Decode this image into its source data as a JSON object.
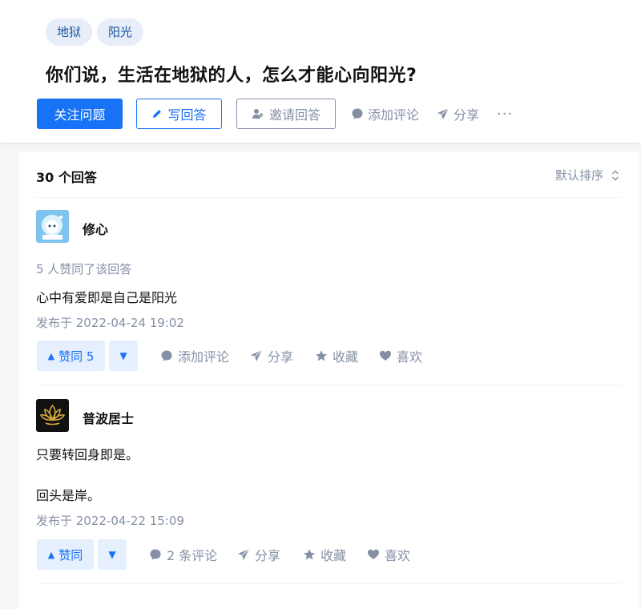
{
  "question": {
    "tags": [
      "地狱",
      "阳光"
    ],
    "title": "你们说，生活在地狱的人，怎么才能心向阳光?",
    "follow_label": "关注问题",
    "write_label": "写回答",
    "invite_label": "邀请回答",
    "comment_label": "添加评论",
    "share_label": "分享",
    "more_label": "···"
  },
  "list": {
    "count_label": "30 个回答",
    "sort_label": "默认排序"
  },
  "answers": [
    {
      "author": "修心",
      "agree_text": "5 人赞同了该回答",
      "content": [
        "心中有爱即是自己是阳光"
      ],
      "published": "发布于 2022-04-24 19:02",
      "vote_label": "赞同 5",
      "comment_label": "添加评论",
      "share_label": "分享",
      "collect_label": "收藏",
      "like_label": "喜欢"
    },
    {
      "author": "普波居士",
      "content": [
        "只要转回身即是。",
        "回头是岸。"
      ],
      "published": "发布于 2022-04-22 15:09",
      "vote_label": "赞同",
      "comment_label": "2 条评论",
      "share_label": "分享",
      "collect_label": "收藏",
      "like_label": "喜欢"
    }
  ],
  "colors": {
    "accent": "#1772f6",
    "muted": "#8590a6",
    "tag_bg": "#e8eef9",
    "vote_bg": "#e5effe"
  }
}
